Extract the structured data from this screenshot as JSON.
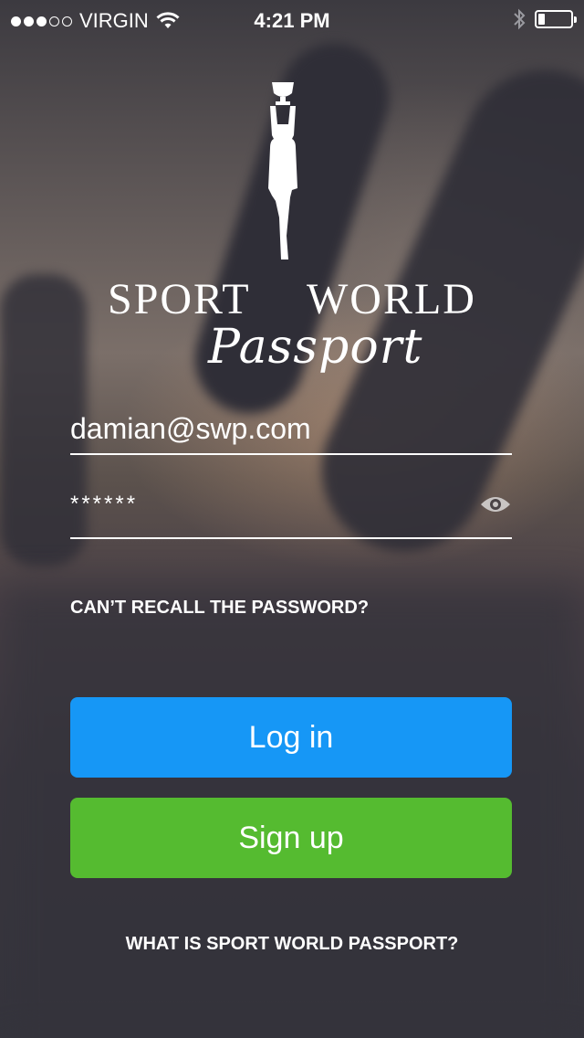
{
  "status_bar": {
    "carrier": "VIRGIN",
    "time": "4:21 PM",
    "signal_dots_filled": 3,
    "signal_dots_total": 5,
    "battery_level": 0.2
  },
  "logo": {
    "word_left": "SPORT",
    "word_right": "WORLD",
    "script": "Passport"
  },
  "login_form": {
    "email_value": "damian@swp.com",
    "password_value": "******"
  },
  "links": {
    "recall_password": "CAN’T RECALL THE PASSWORD?",
    "what_is": "WHAT IS SPORT WORLD PASSPORT?"
  },
  "buttons": {
    "login_label": "Log in",
    "signup_label": "Sign up"
  },
  "colors": {
    "login_button": "#1697f6",
    "signup_button": "#55bb30"
  }
}
